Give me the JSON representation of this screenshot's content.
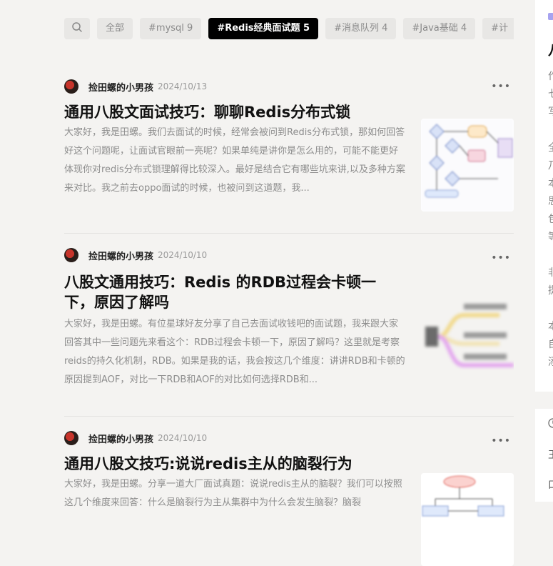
{
  "tagbar": {
    "search_icon": "search-icon",
    "tags": [
      {
        "label": "全部",
        "active": false
      },
      {
        "label": "#mysql 9",
        "active": false
      },
      {
        "label": "#Redis经典面试题 5",
        "active": true
      },
      {
        "label": "#消息队列 4",
        "active": false
      },
      {
        "label": "#Java基础 4",
        "active": false
      },
      {
        "label": "#计",
        "active": false
      }
    ]
  },
  "articles": [
    {
      "author": "捡田螺的小男孩",
      "date": "2024/10/13",
      "more": "•••",
      "title": "通用八股文面试技巧：聊聊Redis分布式锁",
      "summary": "大家好，我是田螺。我们去面试的时候，经常会被问到Redis分布式锁，那如何回答好这个问题呢，让面试官眼前一亮呢？如果单纯是讲你是怎么用的，可能不能更好体现你对redis分布式锁理解得比较深入。最好是结合它有哪些坑来讲,以及多种方案来对比。我之前去oppo面试的时候，也被问到这道题，我..."
    },
    {
      "author": "捡田螺的小男孩",
      "date": "2024/10/10",
      "more": "•••",
      "title": "八股文通用技巧：Redis 的RDB过程会卡顿一下，原因了解吗",
      "summary": "大家好，我是田螺。有位星球好友分享了自己去面试收钱吧的面试题，我来跟大家回答其中一些问题先来看这个：RDB过程会卡顿一下，原因了解吗？这里就是考察reids的持久化机制，RDB。如果是我的话，我会按这几个维度：讲讲RDB和卡顿的原因提到AOF，对比一下RDB和AOF的对比如何选择RDB和..."
    },
    {
      "author": "捡田螺的小男孩",
      "date": "2024/10/10",
      "more": "•••",
      "title": "通用八股文技巧:说说redis主从的脑裂行为",
      "summary": "大家好，我是田螺。分享一道大厂面试真题：说说redis主从的脑裂？我们可以按照这几个维度来回答：什么是脑裂行为主从集群中为什么会发生脑裂？脑裂"
    }
  ],
  "right_panel": {
    "heading_char": "八",
    "chars": [
      "作",
      "七",
      "写",
      "全",
      "乃",
      "本",
      "思",
      "包",
      "等",
      "非",
      "提",
      "本",
      "自",
      "添"
    ],
    "lower_icon": "clock-icon",
    "lower_chars": [
      "王",
      "口"
    ]
  }
}
